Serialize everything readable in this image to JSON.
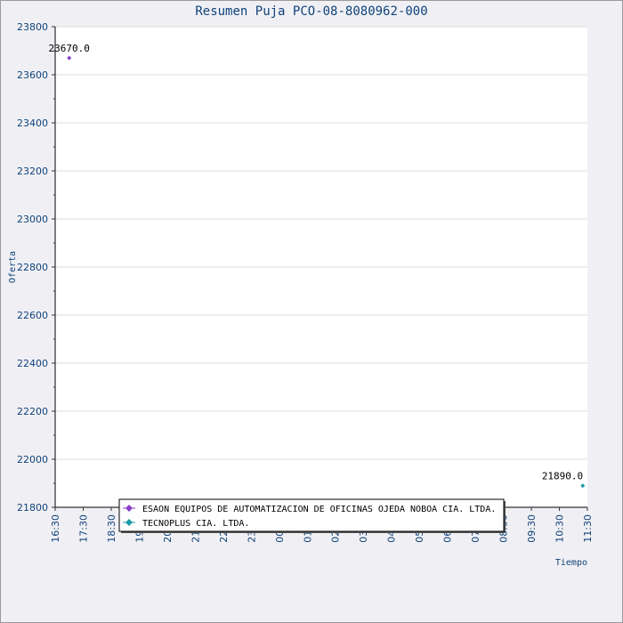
{
  "chart_data": {
    "type": "scatter",
    "title": "Resumen Puja PCO-08-8080962-000",
    "xlabel": "Tiempo",
    "ylabel": "Oferta",
    "ylim": [
      21800,
      23800
    ],
    "yticks": [
      21800,
      22000,
      22200,
      22400,
      22600,
      22800,
      23000,
      23200,
      23400,
      23600,
      23800
    ],
    "xticks": [
      "16:30",
      "17:30",
      "18:30",
      "19:30",
      "20:30",
      "21:30",
      "22:30",
      "23:30",
      "00:30",
      "01:30",
      "02:30",
      "03:30",
      "04:30",
      "05:30",
      "06:30",
      "07:30",
      "08:30",
      "09:30",
      "10:30",
      "11:30"
    ],
    "grid": true,
    "legend_position": "bottom",
    "series": [
      {
        "name": "ESAON EQUIPOS DE AUTOMATIZACION DE OFICINAS OJEDA NOBOA CIA. LTDA.",
        "color": "#8a3ec8",
        "points": [
          {
            "x": "17:00",
            "y": 23670.0,
            "label": "23670.0"
          }
        ]
      },
      {
        "name": "TECNOPLUS CIA. LTDA.",
        "color": "#1b9aa8",
        "points": [
          {
            "x": "11:20",
            "y": 21890.0,
            "label": "21890.0"
          }
        ]
      }
    ]
  }
}
